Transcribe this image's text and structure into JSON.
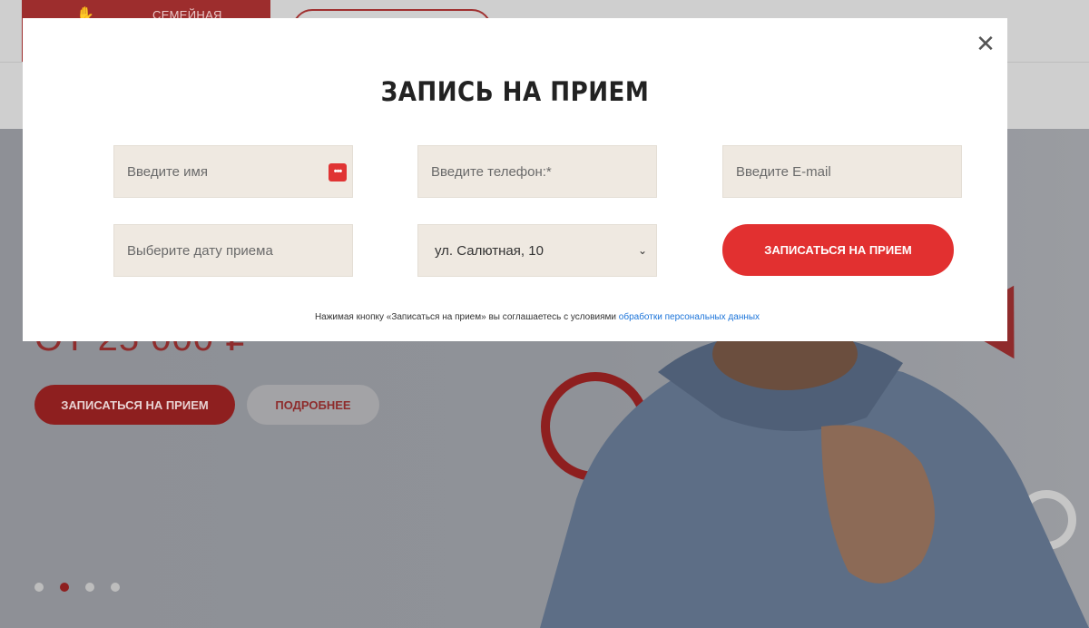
{
  "header": {
    "brand_text": "СЕМЕЙНАЯ"
  },
  "hero": {
    "price": "ОТ 25 000 ₽",
    "primary_button": "ЗАПИСАТЬСЯ НА ПРИЕМ",
    "secondary_button": "ПОДРОБНЕЕ",
    "slides": 4,
    "active_slide": 2
  },
  "modal": {
    "close_symbol": "✕",
    "title": "ЗАПИСЬ НА ПРИЕМ",
    "fields": {
      "name_placeholder": "Введите имя",
      "phone_placeholder": "Введите телефон:*",
      "email_placeholder": "Введите E-mail",
      "date_placeholder": "Выберите дату приема",
      "clinic_selected": "ул. Салютная, 10"
    },
    "submit_button": "ЗАПИСАТЬСЯ НА ПРИЕМ",
    "consent_text": "Нажимая кнопку «Записаться на прием» вы соглашаетесь с условиями",
    "consent_link": "обработки персональных данных"
  },
  "colors": {
    "accent": "#e23030",
    "field_bg": "#efe9e1",
    "link": "#1a73d9"
  },
  "icons": [
    "close-icon",
    "password-manager-icon",
    "chevron-down-icon",
    "hand-logo-icon"
  ]
}
